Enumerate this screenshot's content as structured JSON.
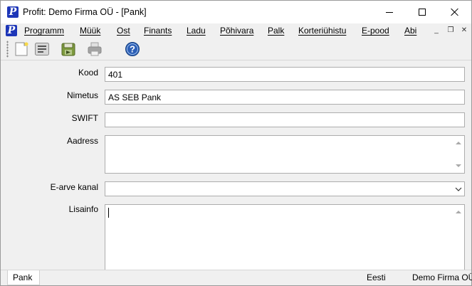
{
  "window": {
    "title": "Profit: Demo Firma OÜ - [Pank]",
    "logo_letter": "P"
  },
  "menu": {
    "items": [
      "Programm",
      "Müük",
      "Ost",
      "Finants",
      "Ladu",
      "Põhivara",
      "Palk",
      "Korteriühistu",
      "E-pood",
      "Abi"
    ],
    "mdi_min": "_",
    "mdi_restore": "❐",
    "mdi_close": "✕"
  },
  "toolbar": {
    "buttons": [
      "new-document-icon",
      "form-icon",
      "save-icon",
      "print-icon",
      "help-icon"
    ],
    "help_glyph": "?"
  },
  "form": {
    "kood_label": "Kood",
    "kood_value": "401",
    "nimetus_label": "Nimetus",
    "nimetus_value": "AS SEB Pank",
    "swift_label": "SWIFT",
    "swift_value": "",
    "aadress_label": "Aadress",
    "aadress_value": "",
    "earve_label": "E-arve kanal",
    "earve_value": "",
    "lisainfo_label": "Lisainfo",
    "lisainfo_value": ""
  },
  "statusbar": {
    "tab": "Pank",
    "language": "Eesti",
    "company": "Demo Firma OÜ"
  },
  "colors": {
    "logo_blue": "#1d36b8",
    "window_bg": "#f0f0f0",
    "help_blue": "#2c5fb6"
  }
}
